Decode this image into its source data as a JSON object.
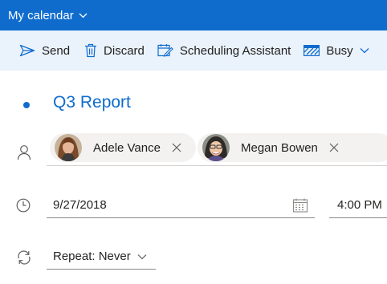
{
  "app": {
    "title": "My calendar"
  },
  "toolbar": {
    "send": {
      "label": "Send",
      "icon": "send-icon"
    },
    "discard": {
      "label": "Discard",
      "icon": "trash-icon"
    },
    "scheduling": {
      "label": "Scheduling Assistant",
      "icon": "scheduling-assistant-icon"
    },
    "busy": {
      "label": "Busy",
      "icon": "busy-status-icon"
    }
  },
  "event": {
    "title": "Q3 Report"
  },
  "attendees": [
    {
      "name": "Adele Vance",
      "avatar": "avatar-photo"
    },
    {
      "name": "Megan Bowen",
      "avatar": "avatar-photo"
    }
  ],
  "date": {
    "value": "9/27/2018",
    "icon": "calendar-icon"
  },
  "time": {
    "value": "4:00 PM"
  },
  "repeat": {
    "label": "Repeat: Never",
    "icon": "repeat-icon"
  },
  "colors": {
    "accent": "#0f6ccd",
    "toolbar_bg": "#eaf2fb",
    "chip_bg": "#f3f2f1"
  }
}
